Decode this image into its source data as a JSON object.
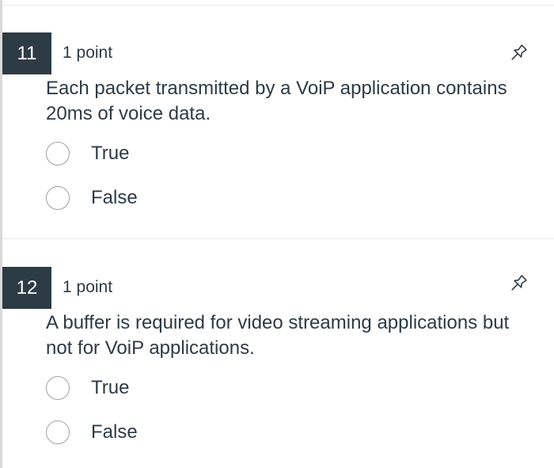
{
  "questions": [
    {
      "number": "11",
      "points": "1 point",
      "text": "Each packet transmitted by a VoiP application contains 20ms of voice data.",
      "options": [
        "True",
        "False"
      ]
    },
    {
      "number": "12",
      "points": "1 point",
      "text": "A buffer is required for video streaming applications but not for VoiP applications.",
      "options": [
        "True",
        "False"
      ]
    }
  ],
  "icons": {
    "pin": "pin-icon"
  },
  "colors": {
    "number_badge": "#2d3b45",
    "text": "#2d3b45",
    "radio_border": "#9aa3aa"
  }
}
